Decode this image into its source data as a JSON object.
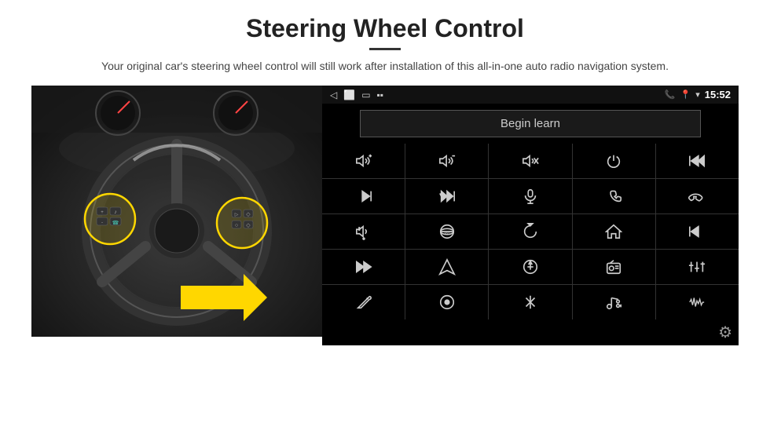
{
  "header": {
    "title": "Steering Wheel Control",
    "subtitle": "Your original car's steering wheel control will still work after installation of this all-in-one auto radio navigation system."
  },
  "status_bar": {
    "time": "15:52",
    "icons": [
      "back-arrow",
      "window-icon",
      "square-icon",
      "signal-icon"
    ]
  },
  "begin_learn": {
    "label": "Begin learn"
  },
  "icon_grid": {
    "rows": [
      [
        "vol-up",
        "vol-down",
        "mute",
        "power",
        "prev-track-call"
      ],
      [
        "next-track",
        "fast-forward",
        "mic",
        "phone",
        "hang-up"
      ],
      [
        "speaker",
        "360-view",
        "back",
        "home",
        "skip-back"
      ],
      [
        "fast-fwd2",
        "navigate",
        "eq",
        "radio",
        "equalizer"
      ],
      [
        "edit",
        "circle-dot",
        "bluetooth",
        "music-settings",
        "waveform"
      ]
    ]
  },
  "colors": {
    "background": "#ffffff",
    "panel_bg": "#000000",
    "icon_color": "#cccccc",
    "title_color": "#222222",
    "divider_color": "#333333",
    "begin_btn_bg": "#1a1a1a",
    "begin_btn_border": "#555555"
  }
}
